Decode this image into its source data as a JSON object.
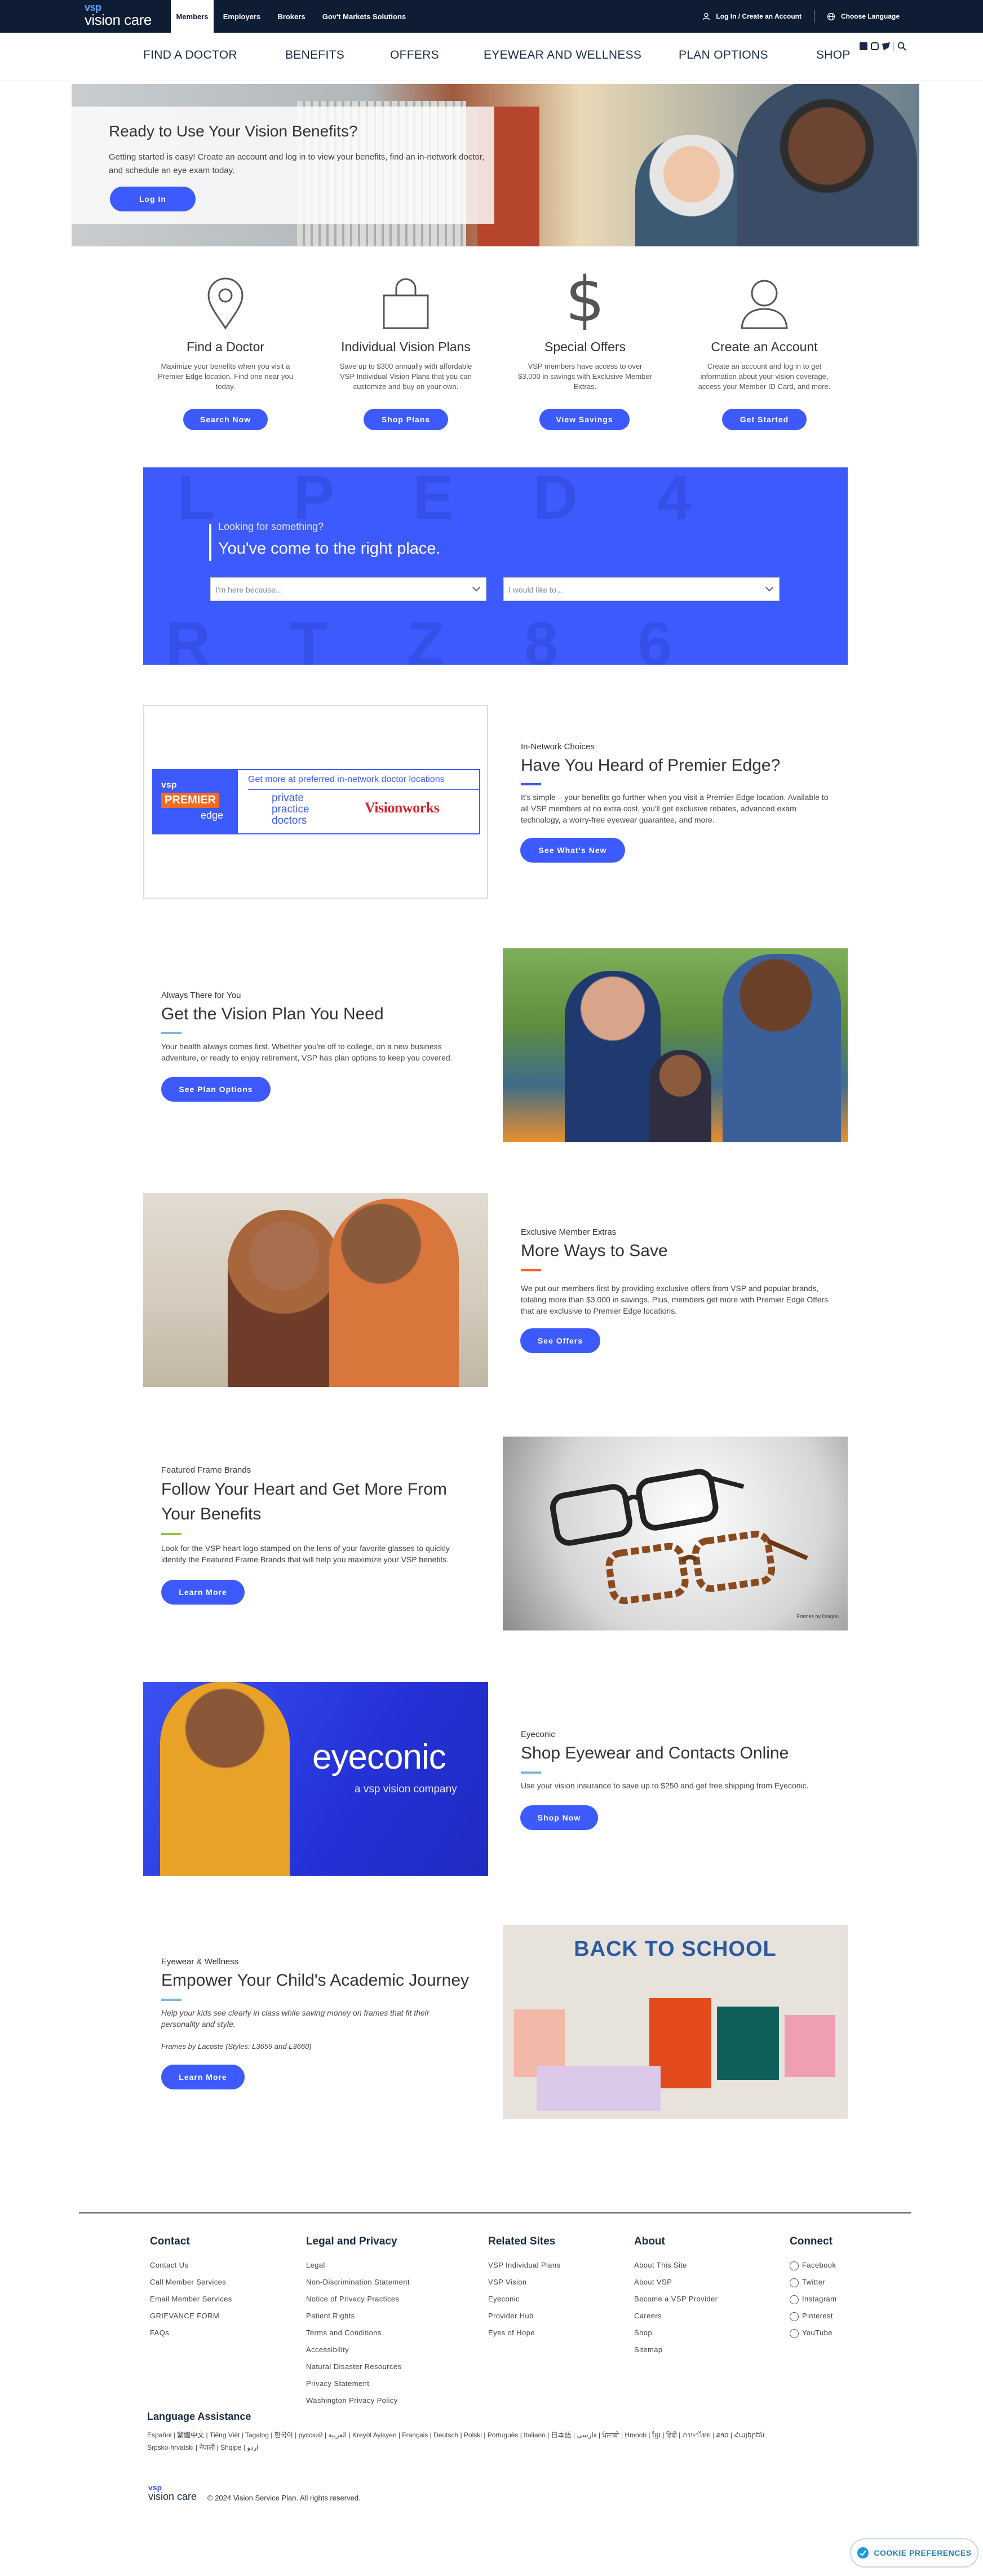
{
  "topbar": {
    "logo_top": "vsp",
    "logo_bottom": "vision care",
    "audience": [
      "Members",
      "Employers",
      "Brokers",
      "Gov't Markets Solutions"
    ],
    "login": "Log In / Create an Account",
    "language": "Choose Language"
  },
  "nav": {
    "items": [
      "FIND A DOCTOR",
      "BENEFITS",
      "OFFERS",
      "EYEWEAR AND WELLNESS",
      "PLAN OPTIONS",
      "SHOP"
    ]
  },
  "hero": {
    "title": "Ready to Use Your Vision Benefits?",
    "text": "Getting started is easy! Create an account and log in to view your benefits, find an in-network doctor, and schedule an eye exam today.",
    "button": "Log In"
  },
  "features": [
    {
      "icon": "location-pin-icon",
      "title": "Find a Doctor",
      "text": "Maximize your benefits when you visit a Premier Edge location. Find one near you today.",
      "button": "Search Now"
    },
    {
      "icon": "shopping-bag-icon",
      "title": "Individual Vision Plans",
      "text": "Save up to $300 annually with affordable VSP Individual Vision Plans that you can customize and buy on your own.",
      "button": "Shop Plans"
    },
    {
      "icon": "dollar-icon",
      "title": "Special Offers",
      "text": "VSP members have access to over $3,000 in savings with Exclusive Member Extras.",
      "button": "View Savings"
    },
    {
      "icon": "person-icon",
      "title": "Create an Account",
      "text": "Create an account and log in to get information about your vision coverage, access your Member ID Card, and more.",
      "button": "Get Started"
    }
  ],
  "search_band": {
    "small": "Looking for something?",
    "big": "You've come to the right place.",
    "select1": "I'm here because...",
    "select2": "I would like to..."
  },
  "premier_edge": {
    "eyebrow": "In-Network Choices",
    "title": "Have You Heard of Premier Edge?",
    "text": "It's simple – your benefits go further when you visit a Premier Edge location. Available to all VSP members at no extra cost, you'll get exclusive rebates, advanced exam technology, a worry-free eyewear guarantee, and more.",
    "button": "See What's New",
    "banner_vsp": "vsp",
    "banner_premier": "PREMIER",
    "banner_edge": "edge",
    "banner_tagline": "Get more at preferred in-network doctor locations",
    "banner_ppd": "private practice doctors",
    "banner_visionworks": "Visionworks"
  },
  "plan": {
    "eyebrow": "Always There for You",
    "title": "Get the Vision Plan You Need",
    "text": "Your health always comes first. Whether you're off to college, on a new business adventure, or ready to enjoy retirement, VSP has plan options to keep you covered.",
    "button": "See Plan Options"
  },
  "save": {
    "eyebrow": "Exclusive Member Extras",
    "title": "More Ways to Save",
    "text": "We put our members first by providing exclusive offers from VSP and popular brands, totaling more than $3,000 in savings. Plus, members get more with Premier Edge Offers that are exclusive to Premier Edge locations.",
    "button": "See Offers"
  },
  "frames": {
    "eyebrow": "Featured Frame Brands",
    "title": "Follow Your Heart and Get More From Your Benefits",
    "text": "Look for the VSP heart logo stamped on the lens of your favorite glasses to quickly identify the Featured Frame Brands that will help you maximize your VSP benefits.",
    "button": "Learn More",
    "credit": "Frames by Dragon"
  },
  "eyeconic": {
    "eyebrow": "Eyeconic",
    "title": "Shop Eyewear and Contacts Online",
    "text": "Use your vision insurance to save up to $250 and get free shipping from Eyeconic.",
    "button": "Shop Now",
    "logo": "eyeconic",
    "sub": "a vsp vision company"
  },
  "school": {
    "eyebrow": "Eyewear & Wellness",
    "title": "Empower Your Child's Academic Journey",
    "text": "Help your kids see clearly in class while saving money on frames that fit their personality and style.",
    "note": "Frames by Lacoste (Styles: L3659 and L3660)",
    "button": "Learn More",
    "banner": "BACK TO SCHOOL"
  },
  "footer": {
    "columns": [
      {
        "title": "Contact",
        "links": [
          "Contact Us",
          "Call Member Services",
          "Email Member Services",
          "GRIEVANCE FORM",
          "FAQs"
        ]
      },
      {
        "title": "Legal and Privacy",
        "links": [
          "Legal",
          "Non-Discrimination Statement",
          "Notice of Privacy Practices",
          "Patient Rights",
          "Terms and Conditions",
          "Accessibility",
          "Natural Disaster Resources",
          "Privacy Statement",
          "Washington Privacy Policy"
        ]
      },
      {
        "title": "Related Sites",
        "links": [
          "VSP Individual Plans",
          "VSP Vision",
          "Eyeconic",
          "Provider Hub",
          "Eyes of Hope"
        ]
      },
      {
        "title": "About",
        "links": [
          "About This Site",
          "About VSP",
          "Become a VSP Provider",
          "Careers",
          "Shop",
          "Sitemap"
        ]
      },
      {
        "title": "Connect",
        "links": [
          "Facebook",
          "Twitter",
          "Instagram",
          "Pinterest",
          "YouTube"
        ]
      }
    ],
    "language_title": "Language Assistance",
    "language_line1": "Español | 繁體中文 | Tiếng Việt | Tagalog | 한국어 | русский | العربية | Kreyòl Ayisyen | Français | Deutsch | Polski | Português | Italiano | 日本語 | فارسی | ਪੰਜਾਬੀ | Hmoob | ខ្មែរ | हिंदी | ภาษาไทย | ລາວ | Հայերեն",
    "language_line2": "Srpsko-hrvatski | नेपाली | Shqipe | اردو",
    "logo_top": "vsp",
    "logo_bottom": "vision care",
    "copyright": "© 2024 Vision Service Plan. All rights reserved.",
    "cookie": "COOKIE PREFERENCES"
  }
}
